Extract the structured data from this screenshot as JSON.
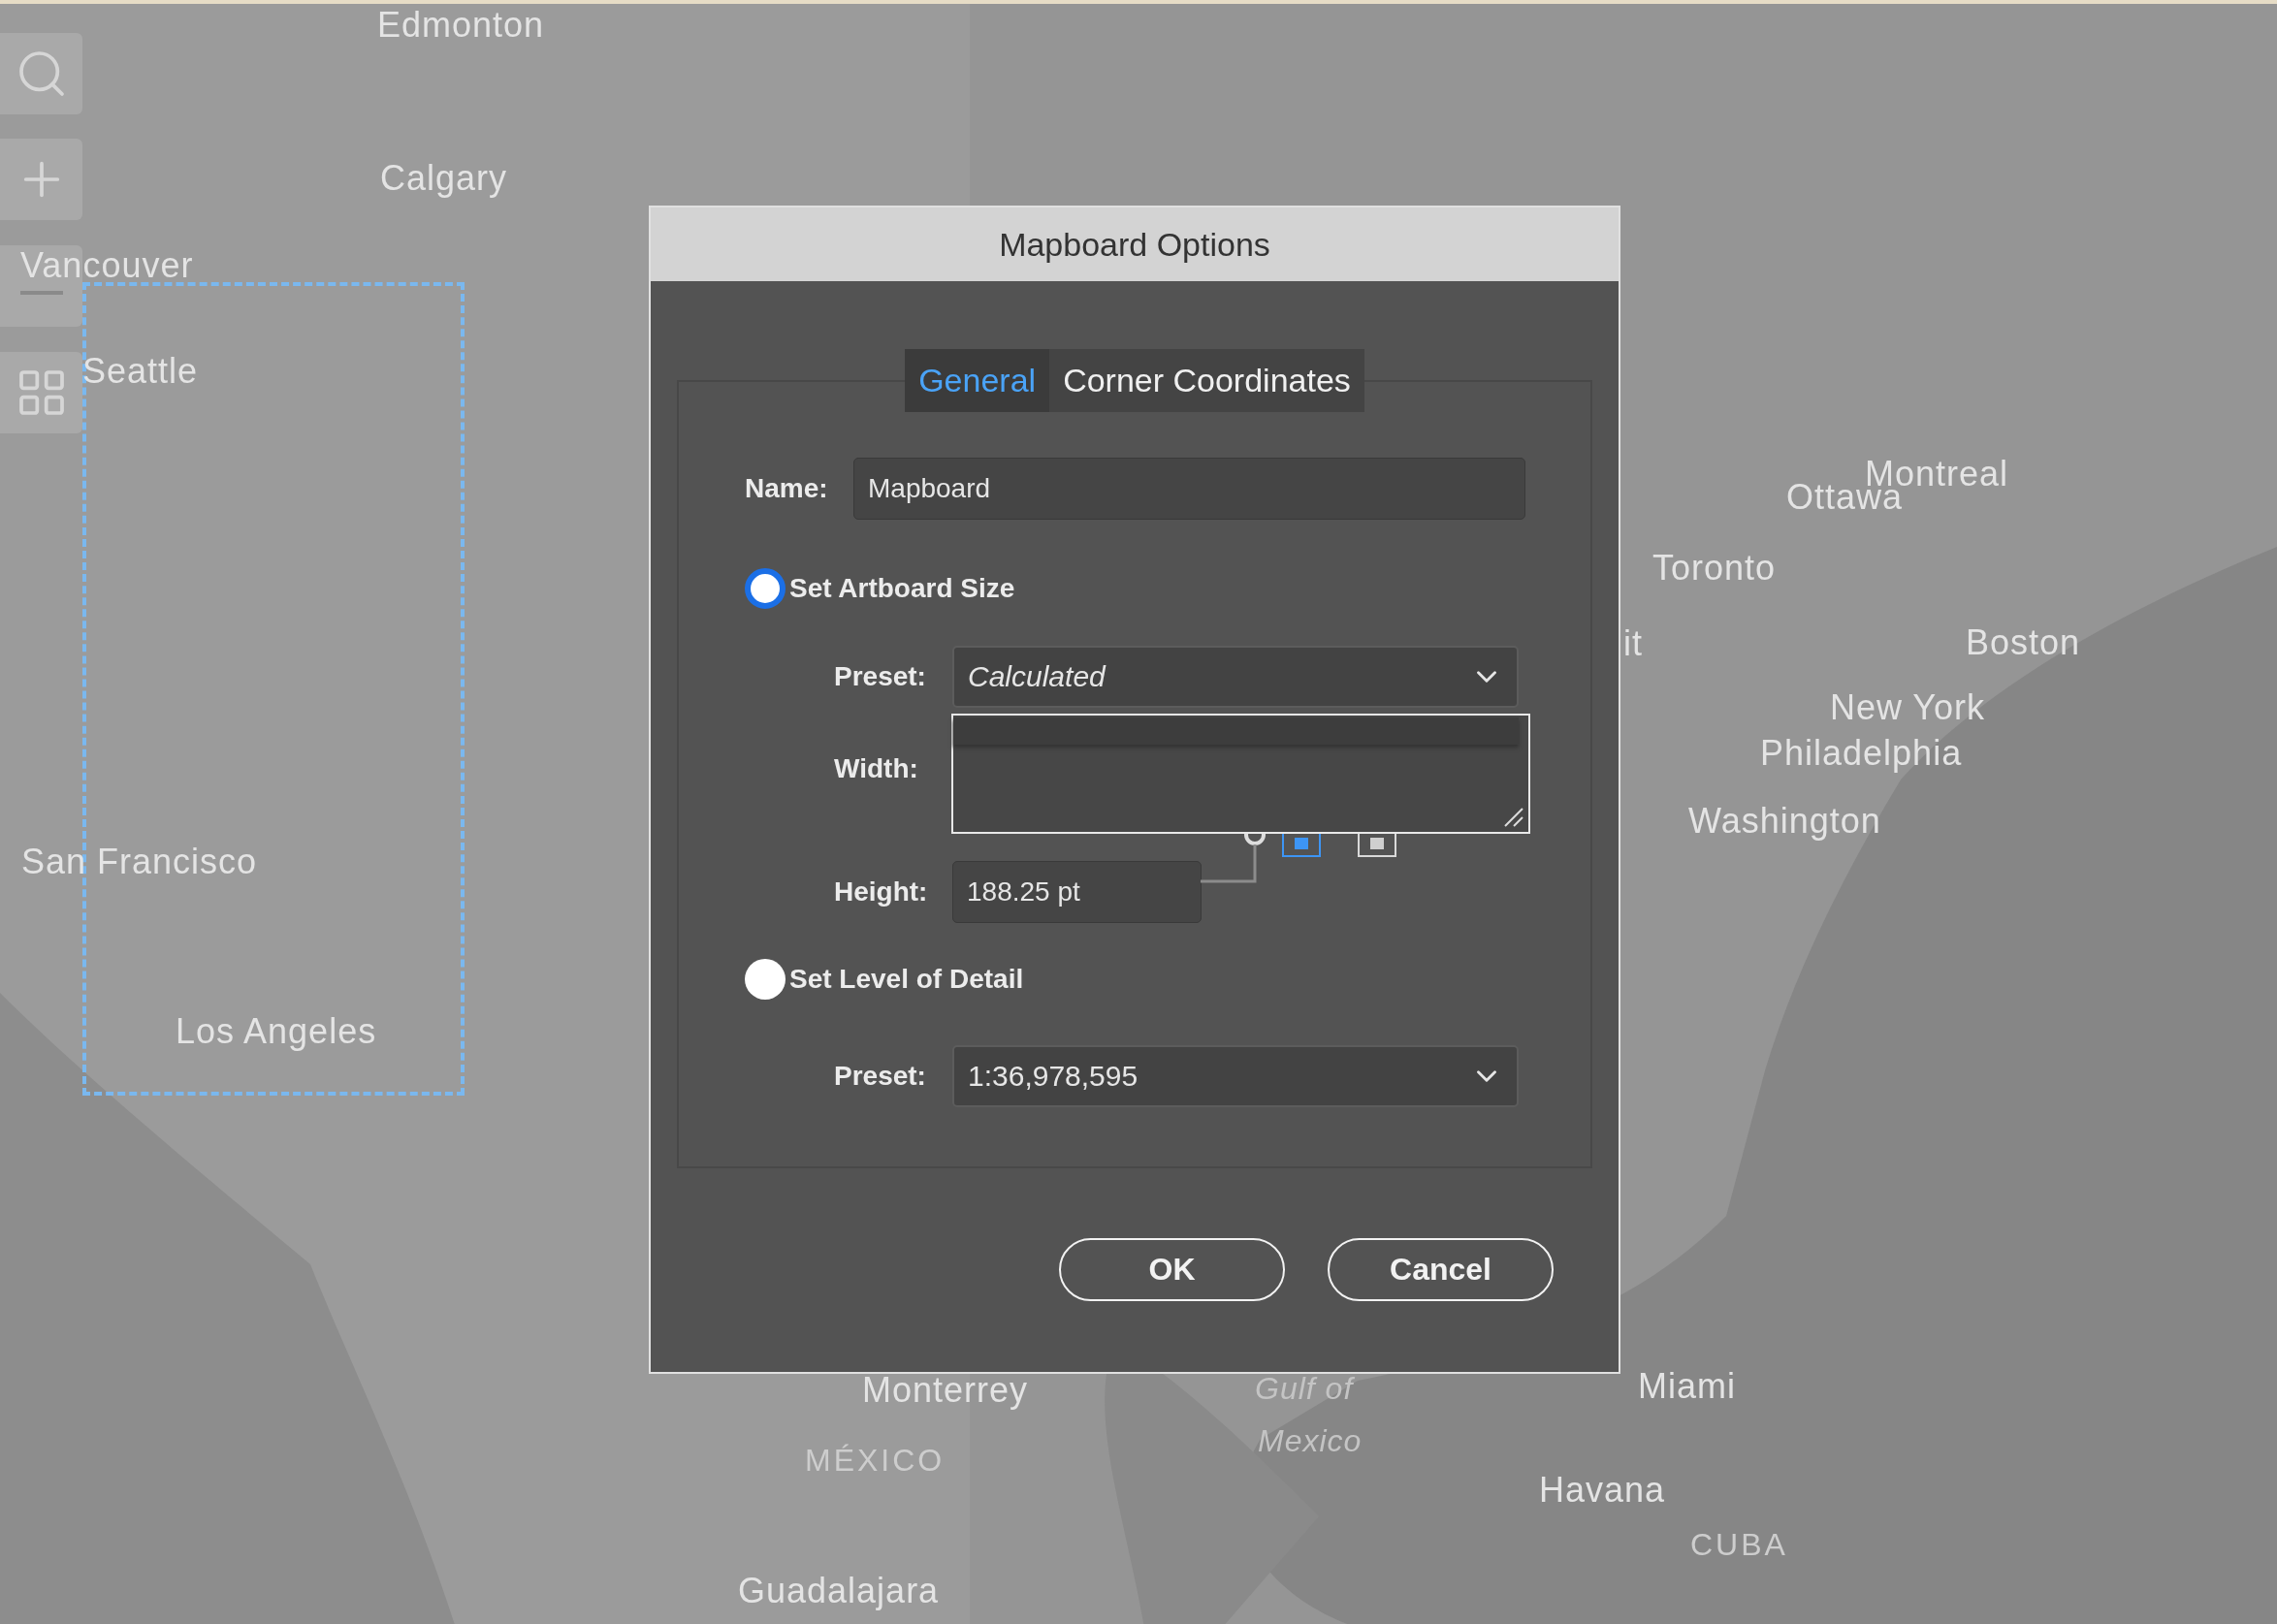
{
  "map_labels": [
    {
      "text": "Edmonton",
      "kind": "city"
    },
    {
      "text": "Calgary",
      "kind": "city"
    },
    {
      "text": "Vancouver",
      "kind": "city"
    },
    {
      "text": "Seattle",
      "kind": "city"
    },
    {
      "text": "San Francisco",
      "kind": "city"
    },
    {
      "text": "Los Angeles",
      "kind": "city"
    },
    {
      "text": "Monterrey",
      "kind": "city"
    },
    {
      "text": "MÉXICO",
      "kind": "country"
    },
    {
      "text": "Guadalajara",
      "kind": "city"
    },
    {
      "text": "Gulf of",
      "kind": "water"
    },
    {
      "text": "Mexico",
      "kind": "water"
    },
    {
      "text": "Miami",
      "kind": "city"
    },
    {
      "text": "Havana",
      "kind": "city"
    },
    {
      "text": "CUBA",
      "kind": "country"
    },
    {
      "text": "Montreal",
      "kind": "city"
    },
    {
      "text": "Ottawa",
      "kind": "city"
    },
    {
      "text": "Toronto",
      "kind": "city"
    },
    {
      "text": "it",
      "kind": "city"
    },
    {
      "text": "Boston",
      "kind": "city"
    },
    {
      "text": "New York",
      "kind": "city"
    },
    {
      "text": "Philadelphia",
      "kind": "city"
    },
    {
      "text": "Washington",
      "kind": "city"
    }
  ],
  "dialog": {
    "title": "Mapboard Options",
    "tabs": [
      {
        "label": "General",
        "selected": true
      },
      {
        "label": "Corner Coordinates",
        "selected": false
      }
    ],
    "name": {
      "label": "Name:",
      "value": "Mapboard"
    },
    "artboard_size": {
      "label": "Set Artboard Size",
      "selected": true,
      "preset": {
        "label": "Preset:",
        "value": "Calculated"
      },
      "width": {
        "label": "Width:"
      },
      "height": {
        "label": "Height:",
        "value": "188.25 pt"
      }
    },
    "orientation": [
      {
        "selected": true
      },
      {
        "selected": false
      }
    ],
    "level_of_detail": {
      "label": "Set Level of Detail",
      "selected": false,
      "preset": {
        "label": "Preset:",
        "value": "1:36,978,595"
      }
    },
    "buttons": [
      "OK",
      "Cancel"
    ]
  }
}
